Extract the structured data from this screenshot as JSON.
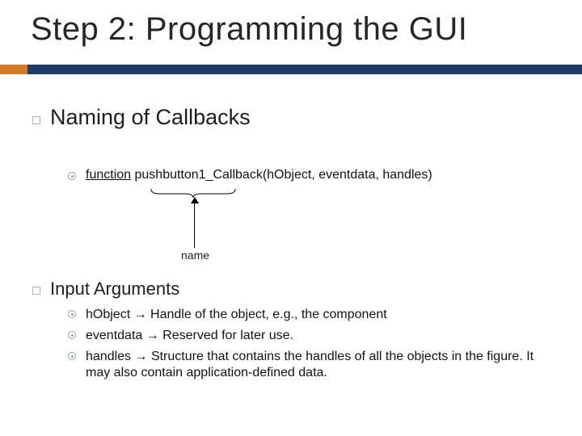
{
  "title": "Step 2: Programming the GUI",
  "section1": {
    "heading": "Naming of Callbacks",
    "code": {
      "kw": "function",
      "rest": " pushbutton1_Callback(hObject, eventdata, handles)"
    },
    "annotation": "name"
  },
  "section2": {
    "heading": "Input Arguments",
    "items": [
      "hObject → Handle of the object, e.g., the component",
      "eventdata → Reserved for later use.",
      "handles → Structure that contains the handles of all the objects in the figure. It may also contain application-defined data."
    ]
  }
}
